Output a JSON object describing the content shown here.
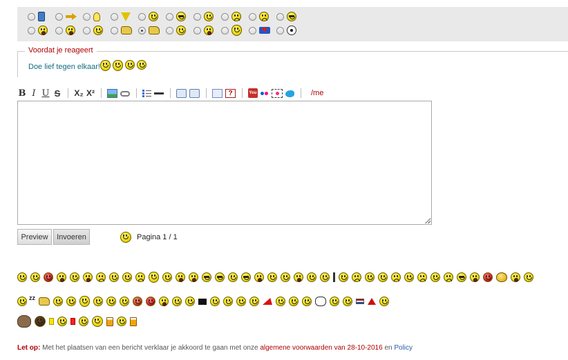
{
  "icon_picker": {
    "row1": [
      "phone-icon",
      "arrow-right-icon",
      "lightbulb-icon",
      "warning-icon",
      "smile-icon",
      "shades-icon",
      "smile-icon",
      "angry-icon",
      "frown-icon",
      "cool-icon"
    ],
    "row2": [
      "grin-icon",
      "surprised-icon",
      "smile-icon",
      "thumbs-down-icon",
      "thumbs-up-icon",
      "smile-icon",
      "tongue-icon",
      "love-icon",
      "superman-icon",
      "soccer-ball-icon"
    ],
    "selected_row": 2,
    "selected_index": 4
  },
  "fieldset": {
    "legend": "Voordat je reageert",
    "text": "Doe lief tegen elkaar!",
    "smilies": [
      "kiss-icon",
      "kiss-icon",
      "smile-icon",
      "smile-icon"
    ]
  },
  "toolbar": {
    "bold": "B",
    "italic": "I",
    "underline": "U",
    "strike": "S",
    "subscript": "X₂",
    "superscript": "X²",
    "youtube": "You",
    "me": "/me"
  },
  "editor": {
    "value": ""
  },
  "buttons": {
    "preview": "Preview",
    "submit": "Invoeren"
  },
  "pagination": {
    "label": "Pagina 1 / 1"
  },
  "smiley_palette": {
    "row1_count": 40,
    "row2_count": 24,
    "row3_count": 8
  },
  "terms": {
    "label": "Let op:",
    "text": "Met het plaatsen van een bericht verklaar je akkoord te gaan met onze",
    "terms_link": "algemene voorwaarden van 28-10-2016",
    "conj": "en",
    "policy_link": "Policy"
  },
  "colors": {
    "picker_bg": "#e9e9e9",
    "legend_red": "#b00000",
    "teal_text": "#146c80",
    "smiley_yellow": "#f6e21b",
    "link_blue": "#2b5ea8"
  }
}
